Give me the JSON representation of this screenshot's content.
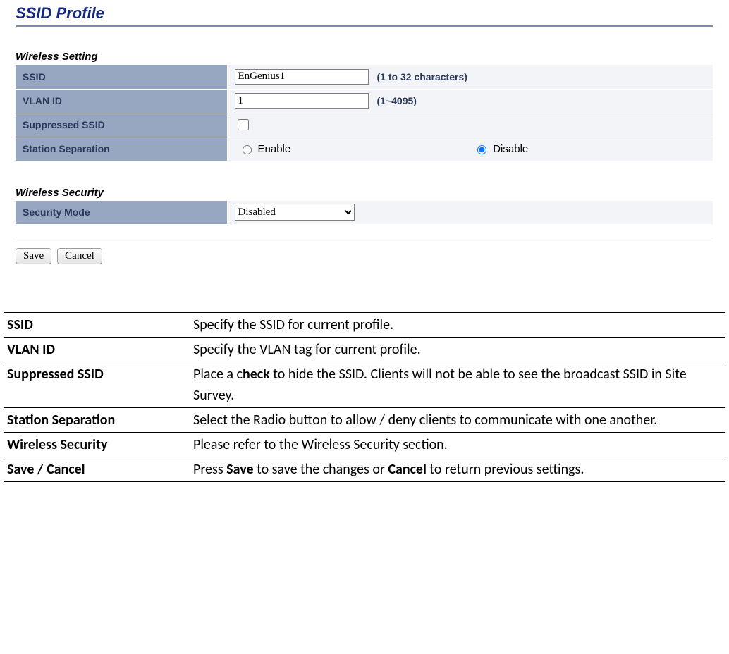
{
  "page": {
    "title": "SSID Profile"
  },
  "wireless_setting": {
    "heading": "Wireless Setting",
    "ssid_label": "SSID",
    "ssid_value": "EnGenius1",
    "ssid_hint": "(1 to 32 characters)",
    "vlan_label": "VLAN ID",
    "vlan_value": "1",
    "vlan_hint": "(1~4095)",
    "suppressed_label": "Suppressed SSID",
    "station_sep_label": "Station Separation",
    "station_sep_enable": "Enable",
    "station_sep_disable": "Disable"
  },
  "wireless_security": {
    "heading": "Wireless Security",
    "mode_label": "Security Mode",
    "mode_value": "Disabled"
  },
  "buttons": {
    "save": "Save",
    "cancel": "Cancel"
  },
  "descriptions": {
    "rows": [
      {
        "label": "SSID",
        "text": "Specify the SSID for current profile."
      },
      {
        "label": "VLAN ID",
        "text": "Specify the VLAN tag for current profile."
      },
      {
        "label": "Suppressed SSID",
        "text": "Place a c",
        "bold1": "heck",
        "text2": " to hide the SSID. Clients will not be able to see the broadcast SSID in Site Survey."
      },
      {
        "label": "Station Separation",
        "text": "Select the Radio button to allow / deny clients to communicate with one another."
      },
      {
        "label": "Wireless Security",
        "text": "Please refer to the Wireless Security section."
      },
      {
        "label": "Save / Cancel",
        "text": "Press ",
        "bold1": "Save",
        "text2": " to save the changes or ",
        "bold2": "Cancel",
        "text3": " to return previous settings."
      }
    ]
  }
}
